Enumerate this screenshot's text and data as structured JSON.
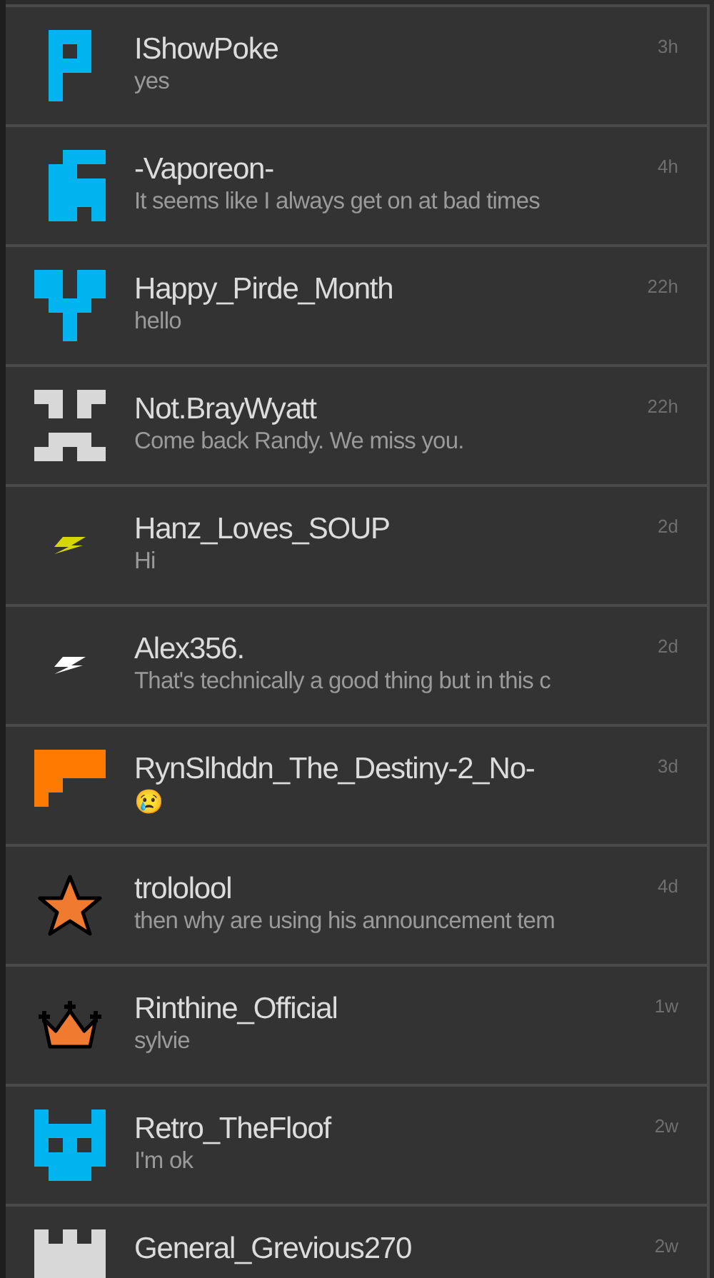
{
  "conversations": [
    {
      "name": "IShowPoke",
      "message": "yes",
      "time": "3h",
      "avatar": {
        "kind": "p",
        "color": "#00b4f0"
      }
    },
    {
      "name": "-Vaporeon-",
      "message": "It seems like I always get on at bad times",
      "time": "4h",
      "avatar": {
        "kind": "ghost",
        "color": "#00b4f0"
      }
    },
    {
      "name": "Happy_Pirde_Month",
      "message": "hello",
      "time": "22h",
      "avatar": {
        "kind": "trident",
        "color": "#00b4f0"
      }
    },
    {
      "name": "Not.BrayWyatt",
      "message": "Come back Randy. We miss you.",
      "time": "22h",
      "avatar": {
        "kind": "face",
        "color": "#d8d8d8"
      }
    },
    {
      "name": "Hanz_Loves_SOUP",
      "message": "Hi",
      "time": "2d",
      "avatar": {
        "kind": "bolt",
        "color": "#d4d800"
      }
    },
    {
      "name": "Alex356.",
      "message": "That's technically a good thing but in this c",
      "time": "2d",
      "avatar": {
        "kind": "bolt",
        "color": "#ffffff"
      }
    },
    {
      "name": "RynSlhddn_The_Destiny-2_No-",
      "message": "😢",
      "time": "3d",
      "avatar": {
        "kind": "flag",
        "color": "#ff7a00"
      }
    },
    {
      "name": "trololool",
      "message": "then why are using his announcement tem",
      "time": "4d",
      "avatar": {
        "kind": "star",
        "color": "#f07a30"
      }
    },
    {
      "name": "Rinthine_Official",
      "message": "sylvie",
      "time": "1w",
      "avatar": {
        "kind": "crown",
        "color": "#f07a30"
      }
    },
    {
      "name": "Retro_TheFloof",
      "message": "I'm ok",
      "time": "2w",
      "avatar": {
        "kind": "cat",
        "color": "#00b4f0"
      }
    },
    {
      "name": "General_Grevious270",
      "time": "2w",
      "avatar": {
        "kind": "castle",
        "color": "#d8d8d8"
      }
    }
  ]
}
